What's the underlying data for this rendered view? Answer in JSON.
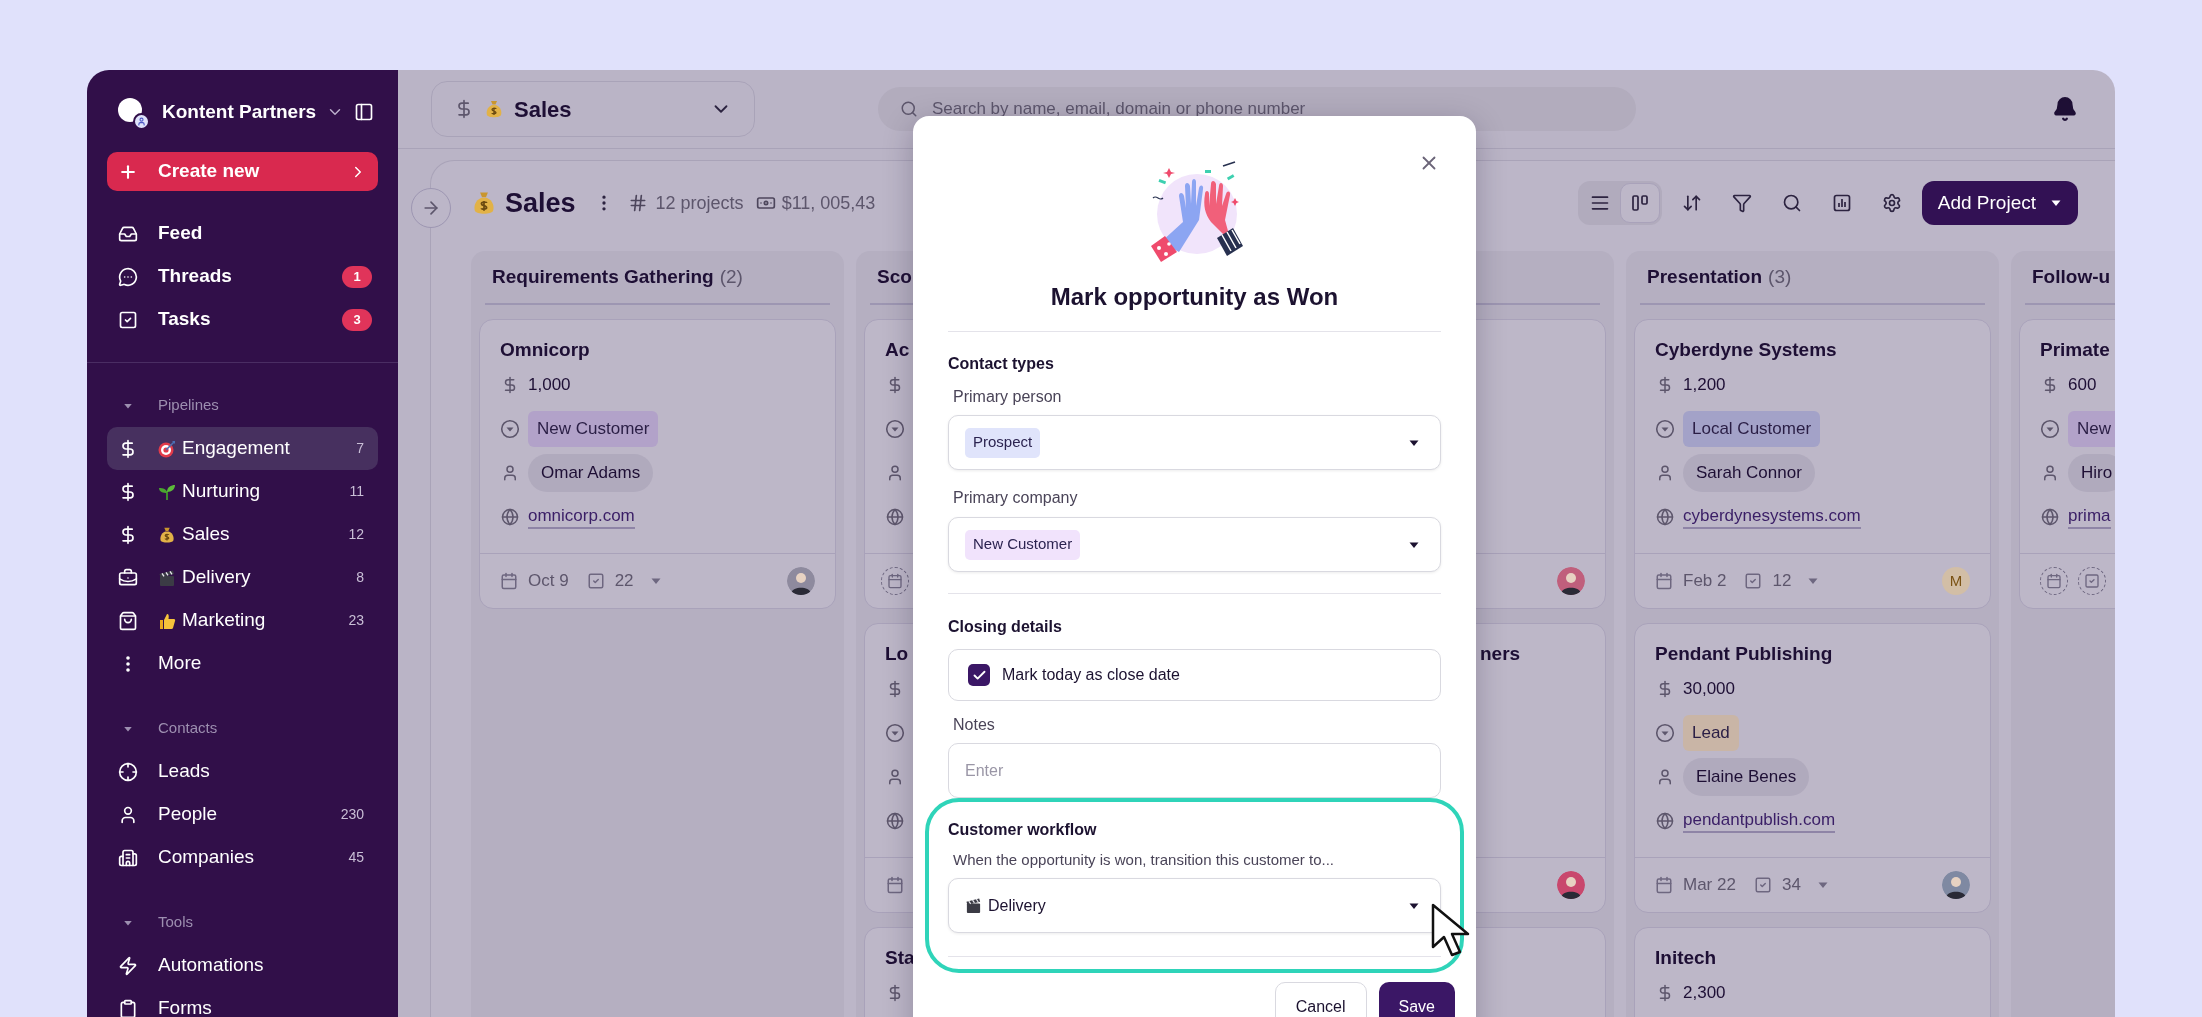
{
  "sidebar": {
    "workspace": "Kontent Partners",
    "create_label": "Create new",
    "nav": [
      {
        "label": "Feed",
        "selected": false
      },
      {
        "label": "Threads",
        "badge": "1",
        "selected": false
      },
      {
        "label": "Tasks",
        "badge": "3",
        "selected": false
      }
    ],
    "sections": [
      {
        "title": "Pipelines",
        "items": [
          {
            "label": "Engagement",
            "count": "7",
            "selected": true
          },
          {
            "label": "Nurturing",
            "count": "11",
            "selected": false
          },
          {
            "label": "Sales",
            "count": "12",
            "selected": false
          },
          {
            "label": "Delivery",
            "count": "8",
            "selected": false
          },
          {
            "label": "Marketing",
            "count": "23",
            "selected": false
          },
          {
            "label": "More",
            "selected": false
          }
        ]
      },
      {
        "title": "Contacts",
        "items": [
          {
            "label": "Leads",
            "selected": false
          },
          {
            "label": "People",
            "count": "230",
            "selected": false
          },
          {
            "label": "Companies",
            "count": "45",
            "selected": false
          }
        ]
      },
      {
        "title": "Tools",
        "items": [
          {
            "label": "Automations",
            "selected": false
          },
          {
            "label": "Forms",
            "selected": false
          }
        ]
      }
    ]
  },
  "topbar": {
    "pipeline": "Sales",
    "search": {
      "placeholder": "Search by name, email, domain or phone number"
    }
  },
  "board": {
    "title": "Sales",
    "projects": "12 projects",
    "total": "$11, 005,43",
    "views": [
      {
        "kind": "list",
        "selected": false
      },
      {
        "kind": "board",
        "selected": true
      }
    ],
    "add_button": "Add Project",
    "columns": [
      {
        "title": "Requirements Gathering",
        "count": "(2)",
        "cards": [
          {
            "kind": "full",
            "title": "Omnicorp",
            "amount": "1,000",
            "stage": {
              "label": "New Customer",
              "color": "#b2a2c9"
            },
            "person": "Omar Adams",
            "website": "omnicorp.com",
            "date": "Oct 9",
            "tasks": "22",
            "owner": {
              "kind": "photo",
              "color": "#8e8a9e"
            }
          }
        ]
      },
      {
        "title": "Sco",
        "cards": [
          {
            "kind": "left-edge",
            "title": "Ac",
            "scheduled": false
          },
          {
            "kind": "left-edge",
            "title": "Lo",
            "scheduled": true
          },
          {
            "kind": "stub",
            "title": "Sta"
          }
        ]
      },
      {
        "cards": [
          {
            "kind": "right-edge",
            "owner": {
              "kind": "photo",
              "color": "#c05f7c"
            }
          },
          {
            "kind": "right-edge",
            "title": "ners",
            "owner": {
              "kind": "photo",
              "color": "#c9476d"
            }
          },
          {
            "kind": "blank"
          }
        ]
      },
      {
        "title": "Presentation",
        "count": "(3)",
        "cards": [
          {
            "kind": "full",
            "title": "Cyberdyne Systems",
            "amount": "1,200",
            "stage": {
              "label": "Local Customer",
              "color": "#a3a2c8"
            },
            "person": "Sarah Connor",
            "website": "cyberdynesystems.com",
            "date": "Feb 2",
            "tasks": "12",
            "owner": {
              "kind": "initial",
              "initial": "M",
              "color": "#d2bea6"
            }
          },
          {
            "kind": "full",
            "title": "Pendant Publishing",
            "amount": "30,000",
            "stage": {
              "label": "Lead",
              "color": "#c9b5a6"
            },
            "person": "Elaine Benes",
            "website": "pendantpublish.com",
            "date": "Mar 22",
            "tasks": "34",
            "owner": {
              "kind": "photo",
              "color": "#7f89a2"
            }
          },
          {
            "kind": "stub",
            "title": "Initech",
            "amount": "2,300"
          }
        ]
      },
      {
        "title": "Follow-u",
        "cards": [
          {
            "kind": "full",
            "title": "Primate",
            "amount": "600",
            "stage": {
              "label": "New",
              "color": "#b2a2c9"
            },
            "person": "Hiro",
            "website": "prima"
          }
        ]
      }
    ]
  },
  "modal": {
    "title": "Mark opportunity as Won",
    "contact_types": {
      "heading": "Contact types",
      "fields": [
        {
          "label": "Primary person",
          "value": "Prospect",
          "color": "#e0e4fb"
        },
        {
          "label": "Primary company",
          "value": "New Customer",
          "color": "#f1e3fc"
        }
      ]
    },
    "closing": {
      "heading": "Closing details",
      "checkbox": {
        "label": "Mark today as close date",
        "checked": true
      },
      "notes": {
        "label": "Notes",
        "placeholder": "Enter"
      }
    },
    "workflow": {
      "heading": "Customer workflow",
      "description": "When the opportunity is won, transition this customer to...",
      "value": "Delivery",
      "highlighted": true
    },
    "buttons": [
      {
        "label": "Cancel",
        "kind": "secondary"
      },
      {
        "label": "Save",
        "kind": "primary"
      }
    ]
  }
}
